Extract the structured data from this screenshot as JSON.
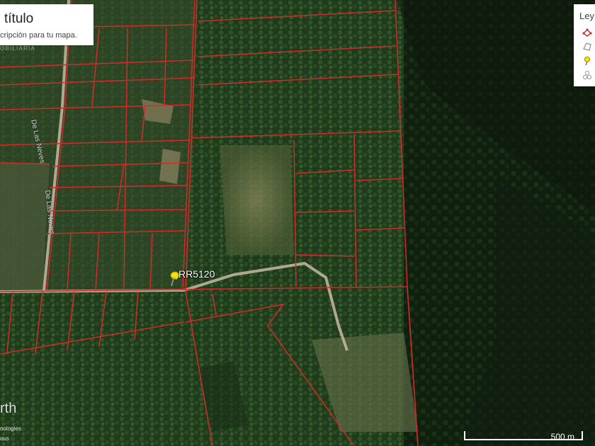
{
  "panel": {
    "title": "título",
    "description": "cripción para tu mapa."
  },
  "watermark": "OBILIARIA",
  "legend": {
    "title": "Ley",
    "items": [
      "polygon-set-icon",
      "polygon-icon",
      "pin-icon",
      "points-icon"
    ]
  },
  "placemark": {
    "label": "RR5120",
    "icon": "yellow-pushpin-icon",
    "color": "#f5e10a"
  },
  "roads": [
    {
      "label": "De Las Neves"
    },
    {
      "label": "De Las Neves"
    }
  ],
  "branding": {
    "name": "rth",
    "credit_1": "nologies",
    "credit_2": "ous"
  },
  "scale": {
    "label": "500 m"
  },
  "colors": {
    "parcel_line": "#d42a2a",
    "road": "#c9b9a4",
    "pin": "#f5e10a"
  }
}
